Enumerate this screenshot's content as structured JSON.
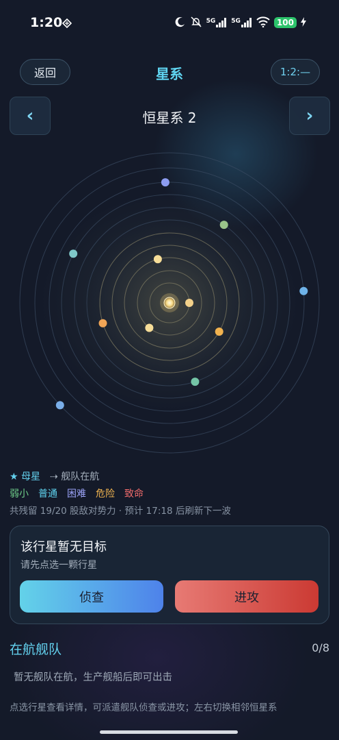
{
  "status_bar": {
    "time": "1:20",
    "signal_1": "5G",
    "signal_2": "5G",
    "battery": "100"
  },
  "header": {
    "back_label": "返回",
    "title": "星系",
    "ratio_label": "1:2:—"
  },
  "system_nav": {
    "prev_label": "‹",
    "next_label": "›",
    "system_name": "恒星系 2"
  },
  "planets": [
    {
      "color": "#8c9cf0",
      "orbit": 9,
      "angle_deg": -92
    },
    {
      "color": "#f3d18a",
      "orbit": 1,
      "angle_deg": 0
    },
    {
      "color": "#f6dd98",
      "orbit": 3,
      "angle_deg": -105
    },
    {
      "color": "#f6dd98",
      "orbit": 2,
      "angle_deg": 129
    },
    {
      "color": "#f1b24f",
      "orbit": 4,
      "angle_deg": 30
    },
    {
      "color": "#f1a556",
      "orbit": 5,
      "angle_deg": 163
    },
    {
      "color": "#9ac48a",
      "orbit": 7,
      "angle_deg": -55
    },
    {
      "color": "#7fc8c8",
      "orbit": 8,
      "angle_deg": -153
    },
    {
      "color": "#74c4a6",
      "orbit": 6,
      "angle_deg": 72
    },
    {
      "color": "#6eb2e8",
      "orbit": 10,
      "angle_deg": -5
    },
    {
      "color": "#7aaee8",
      "orbit": 11,
      "angle_deg": 137
    }
  ],
  "legend": {
    "home_star": "★ 母星",
    "fleet_moving": "⇢ 舰队在航",
    "difficulty": [
      {
        "label": "弱小",
        "color": "#6fcf8a"
      },
      {
        "label": "普通",
        "color": "#5fd4f0"
      },
      {
        "label": "困难",
        "color": "#9aa2f6"
      },
      {
        "label": "危险",
        "color": "#f0b450"
      },
      {
        "label": "致命",
        "color": "#ef6b6b"
      }
    ],
    "status_text": "共残留 19/20 股敌对势力 · 预计 17:18 后刷新下一波"
  },
  "target_card": {
    "title": "该行星暂无目标",
    "subtitle": "请先点选一颗行星",
    "scout_label": "侦查",
    "attack_label": "进攻"
  },
  "fleet": {
    "title": "在航舰队",
    "count": "0/8",
    "empty_text": "暂无舰队在航，生产舰船后即可出击"
  },
  "hint": "点选行星查看详情，可派遣舰队侦查或进攻；左右切换相邻恒星系"
}
